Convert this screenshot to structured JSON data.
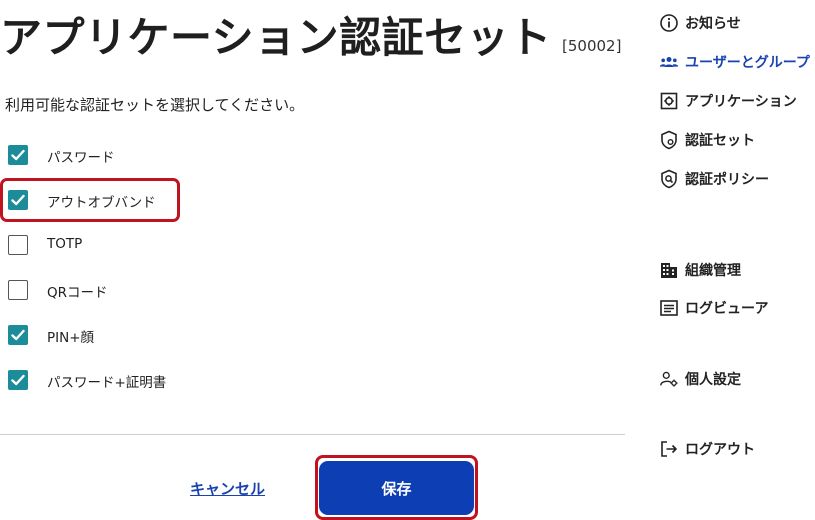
{
  "header": {
    "title": "アプリケーション認証セット",
    "code": "[50002]"
  },
  "instruction": "利用可能な認証セットを選択してください。",
  "options": [
    {
      "label": "パスワード",
      "checked": true
    },
    {
      "label": "アウトオブバンド",
      "checked": true
    },
    {
      "label": "TOTP",
      "checked": false
    },
    {
      "label": "QRコード",
      "checked": false
    },
    {
      "label": "PIN+顔",
      "checked": true
    },
    {
      "label": "パスワード+証明書",
      "checked": true
    }
  ],
  "actions": {
    "cancel_label": "キャンセル",
    "save_label": "保存"
  },
  "sidebar": {
    "items": [
      {
        "label": "お知らせ",
        "icon": "info-icon"
      },
      {
        "label": "ユーザーとグループ",
        "icon": "users-icon",
        "active": true
      },
      {
        "label": "アプリケーション",
        "icon": "app-gear-icon"
      },
      {
        "label": "認証セット",
        "icon": "shield-gear-icon"
      },
      {
        "label": "認証ポリシー",
        "icon": "shield-search-icon"
      },
      {
        "label": "組織管理",
        "icon": "building-icon"
      },
      {
        "label": "ログビューア",
        "icon": "list-window-icon"
      },
      {
        "label": "個人設定",
        "icon": "user-gear-icon"
      },
      {
        "label": "ログアウト",
        "icon": "logout-icon"
      }
    ]
  },
  "colors": {
    "accent": "#0d3eb3",
    "checkbox": "#1c8b9a",
    "highlight": "#c1121f",
    "link": "#1a43b0"
  }
}
